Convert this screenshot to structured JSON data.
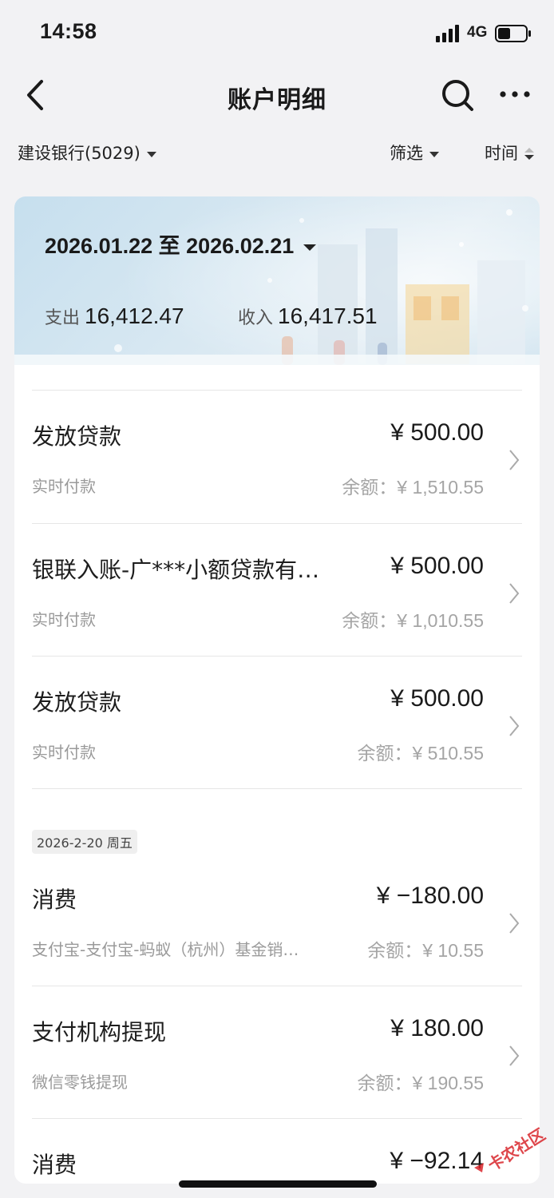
{
  "status_bar": {
    "time": "14:58",
    "network": "4G"
  },
  "nav": {
    "title": "账户明细"
  },
  "filters": {
    "account": "建设银行(5029)",
    "filter_label": "筛选",
    "sort_label": "时间"
  },
  "summary": {
    "date_range": "2026.01.22 至 2026.02.21",
    "expense_label": "支出",
    "expense_value": "16,412.47",
    "income_label": "收入",
    "income_value": "16,417.51"
  },
  "transactions": [
    {
      "title": "发放贷款",
      "amount": "¥ 500.00",
      "subtitle": "实时付款",
      "balance_label": "余额：",
      "balance": "¥ 1,510.55"
    },
    {
      "title": "银联入账-广***小额贷款有…",
      "amount": "¥ 500.00",
      "subtitle": "实时付款",
      "balance_label": "余额：",
      "balance": "¥ 1,010.55"
    },
    {
      "title": "发放贷款",
      "amount": "¥ 500.00",
      "subtitle": "实时付款",
      "balance_label": "余额：",
      "balance": "¥ 510.55"
    },
    {
      "title": "消费",
      "amount": "¥ −180.00",
      "subtitle": "支付宝-支付宝-蚂蚁（杭州）基金销…",
      "balance_label": "余额：",
      "balance": "¥ 10.55"
    },
    {
      "title": "支付机构提现",
      "amount": "¥ 180.00",
      "subtitle": "微信零钱提现",
      "balance_label": "余额：",
      "balance": "¥ 190.55"
    },
    {
      "title": "消费",
      "amount": "¥ −92.14",
      "subtitle": "",
      "balance_label": "",
      "balance": ""
    }
  ],
  "date_groups": [
    {
      "label": "2026-2-20 周五"
    }
  ],
  "watermark": {
    "text": "卡农社区"
  },
  "colors": {
    "background": "#f2f2f4",
    "card": "#ffffff",
    "watermark_red": "#d9262c"
  }
}
